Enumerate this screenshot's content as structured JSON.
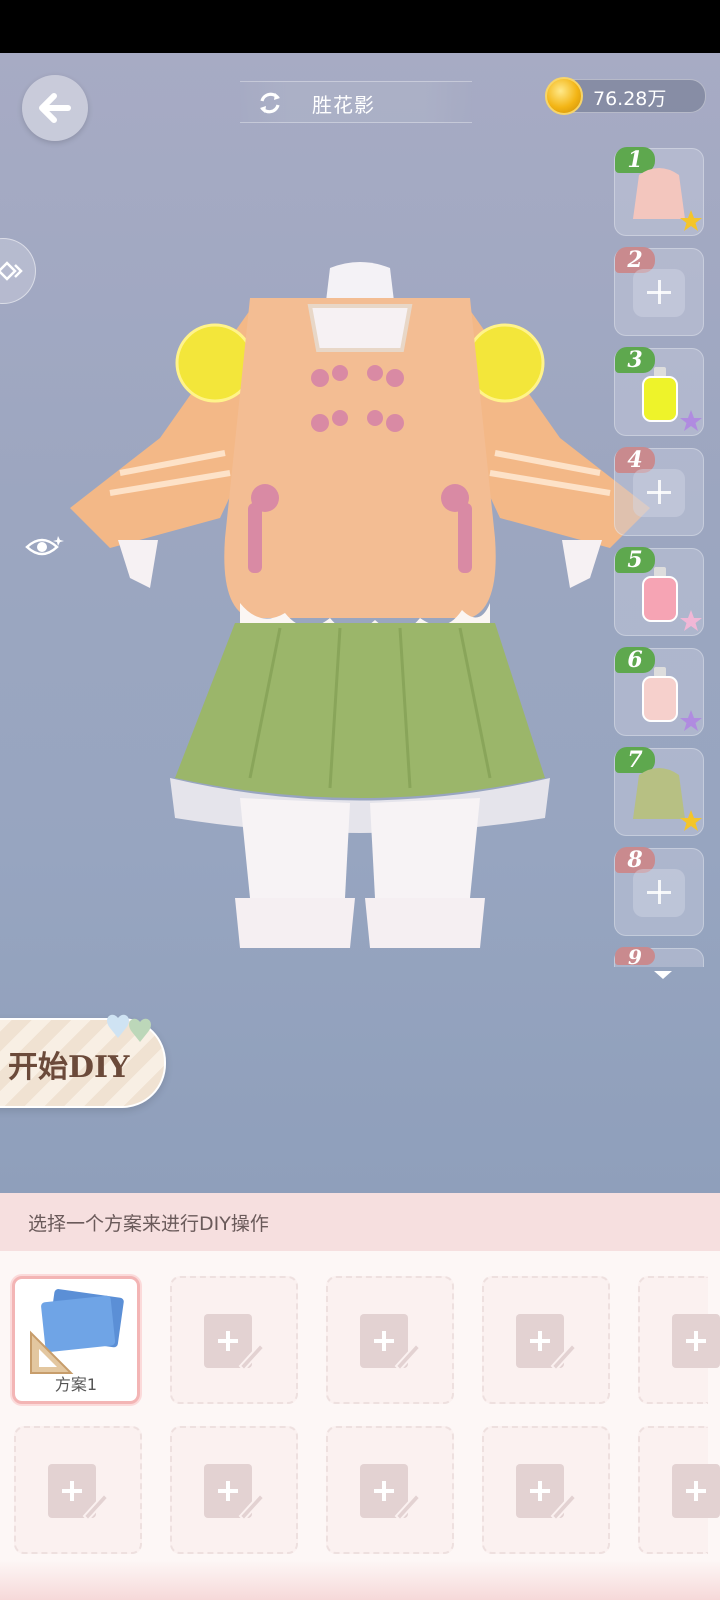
{
  "header": {
    "title": "胜花影",
    "coins": "76.28万"
  },
  "slots": [
    {
      "number": "1",
      "state": "filled",
      "item": "pink cloak",
      "badge": "gold-star"
    },
    {
      "number": "2",
      "state": "empty"
    },
    {
      "number": "3",
      "state": "filled",
      "item": "yellow dye bottle",
      "badge": "purple-star"
    },
    {
      "number": "4",
      "state": "empty"
    },
    {
      "number": "5",
      "state": "filled",
      "item": "pink dye bottle",
      "badge": "rainbow-star"
    },
    {
      "number": "6",
      "state": "filled",
      "item": "light pink dye bottle",
      "badge": "purple-star"
    },
    {
      "number": "7",
      "state": "filled",
      "item": "green cloak",
      "badge": "gold-star"
    },
    {
      "number": "8",
      "state": "empty"
    },
    {
      "number": "9",
      "state": "partial"
    }
  ],
  "diy_button": {
    "label": "开始DIY"
  },
  "bottom_panel": {
    "hint": "选择一个方案来进行DIY操作",
    "plans": [
      {
        "label": "方案1",
        "selected": true
      },
      {
        "label": "",
        "empty": true
      }
    ]
  },
  "colors": {
    "accent_pink": "#f3b5b5",
    "slot_green": "#5ea84e",
    "slot_red": "#c98a8e",
    "coin_gold": "#f3b515"
  }
}
